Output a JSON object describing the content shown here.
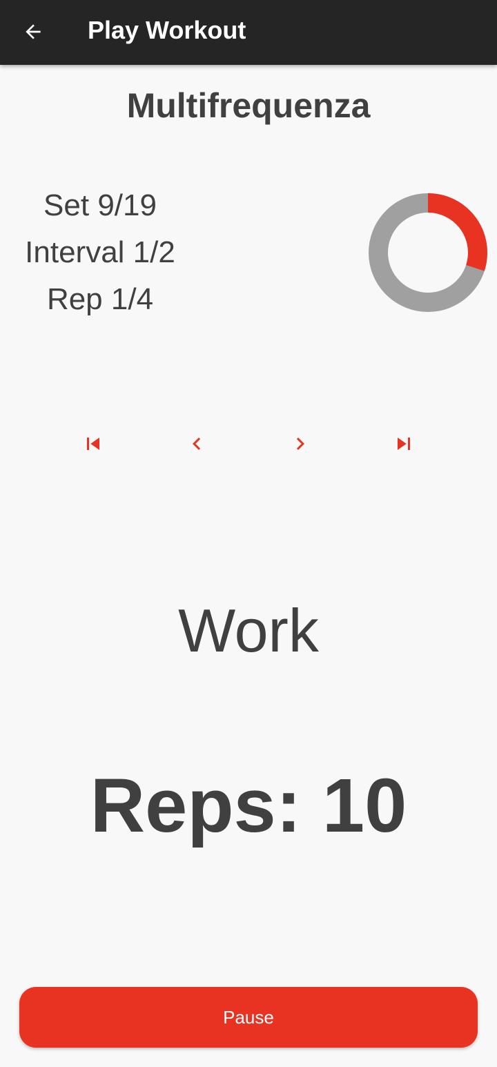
{
  "app_bar": {
    "title": "Play Workout",
    "back_icon": "arrow-left-icon"
  },
  "workout": {
    "name": "Multifrequenza"
  },
  "counters": {
    "set": "Set 9/19",
    "interval": "Interval 1/2",
    "rep": "Rep 1/4"
  },
  "progress_ring": {
    "progress_fraction": 0.3,
    "track_color": "#a0a0a0",
    "fill_color": "#e83323"
  },
  "navigation": {
    "first_icon": "skip-previous-icon",
    "previous_icon": "chevron-left-icon",
    "next_icon": "chevron-right-icon",
    "last_icon": "skip-next-icon"
  },
  "phase": {
    "label": "Work"
  },
  "reps": {
    "label": "Reps: 10"
  },
  "pause_button": {
    "label": "Pause"
  },
  "colors": {
    "accent": "#e83323",
    "app_bar": "#252525",
    "background": "#f8f8f8",
    "text": "#404040"
  }
}
